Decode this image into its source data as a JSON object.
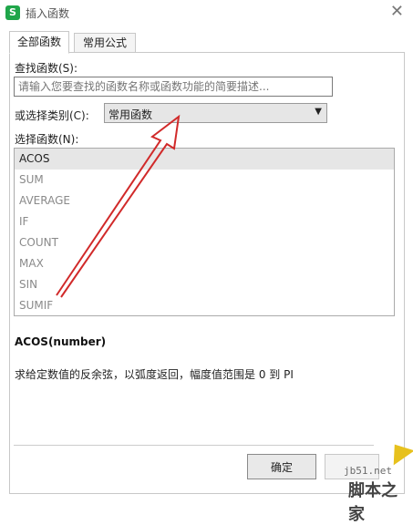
{
  "window": {
    "title": "插入函数",
    "app_icon_letter": "S"
  },
  "tabs": [
    {
      "label": "全部函数",
      "active": true
    },
    {
      "label": "常用公式",
      "active": false
    }
  ],
  "search": {
    "label": "查找函数(S):",
    "placeholder": "请输入您要查找的函数名称或函数功能的简要描述..."
  },
  "category": {
    "label": "或选择类别(C):",
    "selected": "常用函数"
  },
  "function_list": {
    "label": "选择函数(N):",
    "items": [
      "ACOS",
      "SUM",
      "AVERAGE",
      "IF",
      "COUNT",
      "MAX",
      "SIN",
      "SUMIF"
    ],
    "selected_index": 0
  },
  "detail": {
    "signature": "ACOS(number)",
    "description": "求给定数值的反余弦，以弧度返回，幅度值范围是 0 到 PI"
  },
  "buttons": {
    "ok": "确定"
  },
  "watermark": {
    "domain": "jb51.net",
    "site": "脚本之家"
  },
  "colors": {
    "app_icon": "#1fa64a",
    "arrow": "#d12a2a",
    "selected_row": "#e6e6e6"
  }
}
